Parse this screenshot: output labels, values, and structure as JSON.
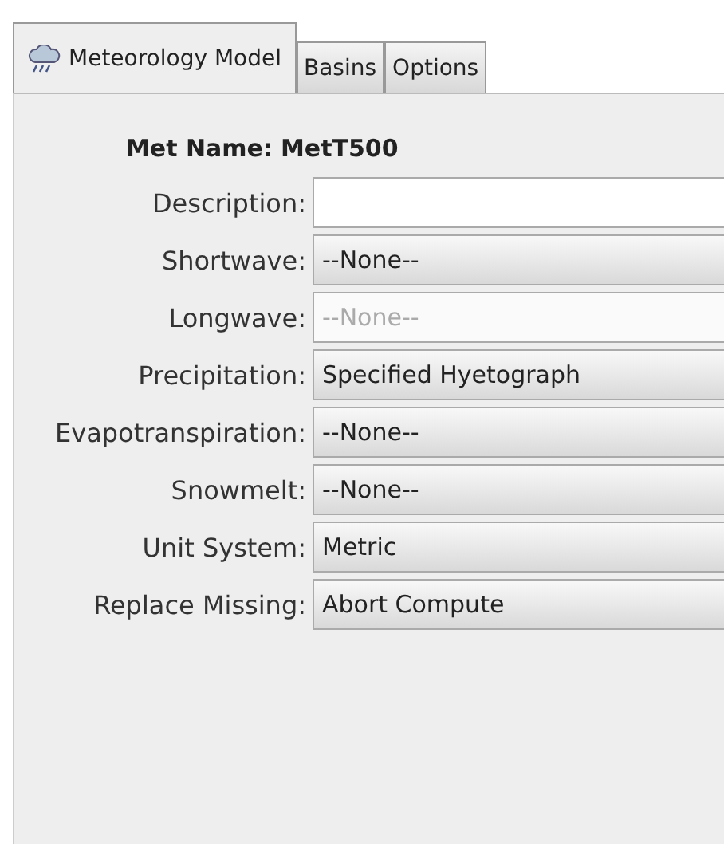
{
  "tabs": [
    {
      "label": "Meteorology Model",
      "selected": true
    },
    {
      "label": "Basins",
      "selected": false
    },
    {
      "label": "Options",
      "selected": false
    }
  ],
  "met_name": {
    "label": "Met Name:",
    "value": "MetT500"
  },
  "fields": [
    {
      "label": "Description:",
      "kind": "text"
    },
    {
      "label": "Shortwave:",
      "kind": "combo",
      "value": "--None--",
      "disabled": false
    },
    {
      "label": "Longwave:",
      "kind": "combo",
      "value": "--None--",
      "disabled": true
    },
    {
      "label": "Precipitation:",
      "kind": "combo",
      "value": "Specified Hyetograph",
      "disabled": false
    },
    {
      "label": "Evapotranspiration:",
      "kind": "combo",
      "value": "--None--",
      "disabled": false
    },
    {
      "label": "Snowmelt:",
      "kind": "combo",
      "value": "--None--",
      "disabled": false
    },
    {
      "label": "Unit System:",
      "kind": "combo",
      "value": "Metric",
      "disabled": false
    },
    {
      "label": "Replace Missing:",
      "kind": "combo",
      "value": "Abort Compute",
      "disabled": false
    }
  ]
}
